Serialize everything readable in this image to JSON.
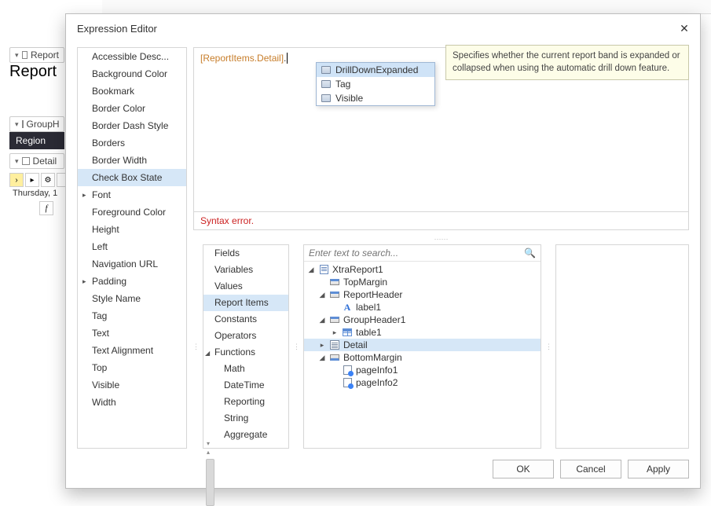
{
  "bg": {
    "reportHeader": "Report",
    "reportBandLabel": "Report",
    "groupHeaderBand": "GroupH",
    "regionLabel": "Region",
    "detailBand": "Detail",
    "thursday": "Thursday, 1"
  },
  "dialog": {
    "title": "Expression Editor",
    "buttons": {
      "ok": "OK",
      "cancel": "Cancel",
      "apply": "Apply"
    }
  },
  "properties": [
    "Accessible Desc...",
    "Background Color",
    "Bookmark",
    "Border Color",
    "Border Dash Style",
    "Borders",
    "Border Width",
    "Check Box State",
    "Font",
    "Foreground Color",
    "Height",
    "Left",
    "Navigation URL",
    "Padding",
    "Style Name",
    "Tag",
    "Text",
    "Text Alignment",
    "Top",
    "Visible",
    "Width"
  ],
  "properties_selected": "Check Box State",
  "properties_expandable": [
    "Font",
    "Padding"
  ],
  "editor": {
    "content_bracket": "[ReportItems.Detail]",
    "content_suffix": ".",
    "error": "Syntax error."
  },
  "autocomplete": {
    "items": [
      "DrillDownExpanded",
      "Tag",
      "Visible"
    ],
    "selected": "DrillDownExpanded"
  },
  "tooltip": "Specifies whether the current report band is expanded or collapsed when using the automatic drill down feature.",
  "categories": {
    "items": [
      "Fields",
      "Variables",
      "Values",
      "Report Items",
      "Constants",
      "Operators",
      "Functions"
    ],
    "selected": "Report Items",
    "functions_children": [
      "Math",
      "DateTime",
      "Reporting",
      "String",
      "Aggregate"
    ]
  },
  "search": {
    "placeholder": "Enter text to search..."
  },
  "tree": {
    "root": "XtraReport1",
    "nodes": [
      {
        "label": "TopMargin",
        "icon": "band-top",
        "indent": 1
      },
      {
        "label": "ReportHeader",
        "icon": "band-hdr",
        "indent": 1,
        "exp": "open"
      },
      {
        "label": "label1",
        "icon": "label",
        "indent": 2
      },
      {
        "label": "GroupHeader1",
        "icon": "band-hdr",
        "indent": 1,
        "exp": "open"
      },
      {
        "label": "table1",
        "icon": "table",
        "indent": 2,
        "exp": "closed"
      },
      {
        "label": "Detail",
        "icon": "detail",
        "indent": 1,
        "exp": "closed",
        "selected": true
      },
      {
        "label": "BottomMargin",
        "icon": "band-bot",
        "indent": 1,
        "exp": "open"
      },
      {
        "label": "pageInfo1",
        "icon": "pageinfo",
        "indent": 2
      },
      {
        "label": "pageInfo2",
        "icon": "pageinfo",
        "indent": 2
      }
    ]
  }
}
